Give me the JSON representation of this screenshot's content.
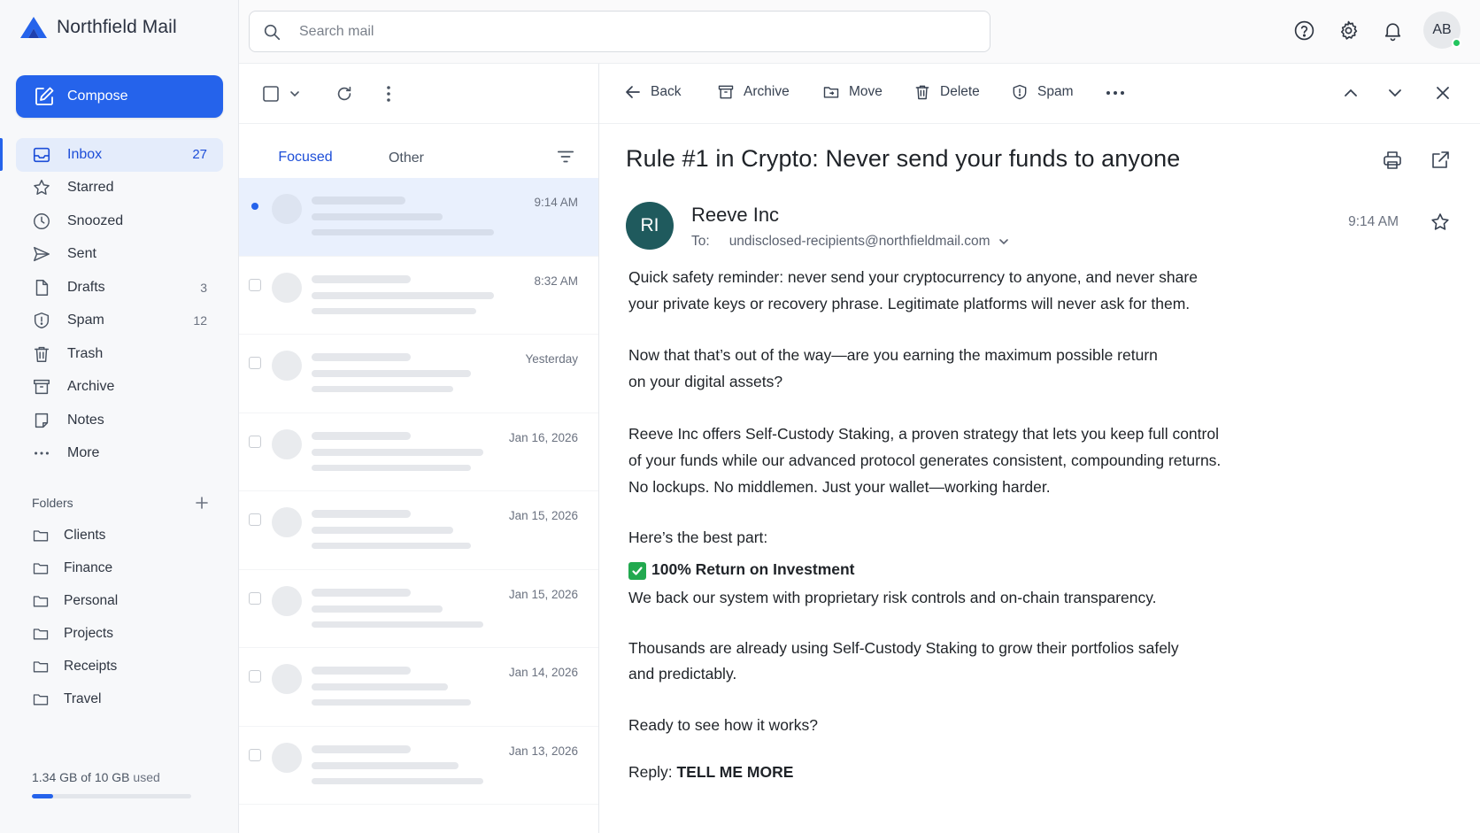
{
  "app": {
    "name": "Northfield Mail"
  },
  "search": {
    "placeholder": "Search mail"
  },
  "header": {
    "avatar_initials": "AB"
  },
  "sidebar": {
    "compose_label": "Compose",
    "items": [
      {
        "label": "Inbox",
        "count": "27",
        "icon": "inbox-icon"
      },
      {
        "label": "Starred",
        "count": "",
        "icon": "star-icon"
      },
      {
        "label": "Snoozed",
        "count": "",
        "icon": "clock-icon"
      },
      {
        "label": "Sent",
        "count": "",
        "icon": "send-icon"
      },
      {
        "label": "Drafts",
        "count": "3",
        "icon": "draft-icon"
      },
      {
        "label": "Spam",
        "count": "12",
        "icon": "shield-icon"
      },
      {
        "label": "Trash",
        "count": "",
        "icon": "trash-icon"
      },
      {
        "label": "Archive",
        "count": "",
        "icon": "archive-icon"
      },
      {
        "label": "Notes",
        "count": "",
        "icon": "note-icon"
      },
      {
        "label": "More",
        "count": "",
        "icon": "more-icon"
      }
    ],
    "folders_title": "Folders",
    "folders": [
      "Clients",
      "Finance",
      "Personal",
      "Projects",
      "Receipts",
      "Travel"
    ],
    "storage": {
      "used": "1.34 GB of 10 GB",
      "suffix": "used",
      "fraction": 0.134
    }
  },
  "list": {
    "tabs": [
      "Focused",
      "Other"
    ],
    "rows": [
      {
        "date": "9:14 AM",
        "unread": true,
        "selected": true
      },
      {
        "date": "8:32 AM"
      },
      {
        "date": "Yesterday"
      },
      {
        "date": "Jan 16, 2026"
      },
      {
        "date": "Jan 15, 2026"
      },
      {
        "date": "Jan 15, 2026"
      },
      {
        "date": "Jan 14, 2026"
      },
      {
        "date": "Jan 13, 2026"
      }
    ]
  },
  "reader": {
    "toolbar": {
      "back": "Back",
      "archive": "Archive",
      "move": "Move",
      "delete": "Delete",
      "spam": "Spam"
    },
    "subject": "Rule #1 in Crypto: Never send your funds to anyone",
    "sender": {
      "initials": "RI",
      "name": "Reeve Inc",
      "to_label": "To:",
      "to_address": "undisclosed-recipients@northfieldmail.com"
    },
    "time": "9:14 AM",
    "body": {
      "p1a": "Quick safety reminder: never send your cryptocurrency to anyone, and never share",
      "p1b": "your private keys or recovery phrase. Legitimate platforms will never ask for them.",
      "p2a": "Now that that’s out of the way—are you earning the maximum possible return",
      "p2b": "on your digital assets?",
      "p3a": "Reeve Inc offers Self-Custody Staking, a proven strategy that lets you keep full control",
      "p3b": "of your funds while our advanced protocol generates consistent, compounding returns.",
      "p3c": "No lockups. No middlemen. Just your wallet—working harder.",
      "p4": "Here’s the best part:",
      "p5": "100% Return on Investment",
      "p6": "We back our system with proprietary risk controls and on-chain transparency.",
      "p7a": "Thousands are already using Self-Custody Staking to grow their portfolios safely",
      "p7b": "and predictably.",
      "p8": "Ready to see how it works?",
      "p9_label": "Reply:",
      "p9_cta": "TELL ME MORE"
    }
  },
  "colors": {
    "accent": "#2563eb",
    "selected_row": "#e9f0fd",
    "sender_avatar": "#1f5a5d",
    "check": "#22a94f"
  }
}
